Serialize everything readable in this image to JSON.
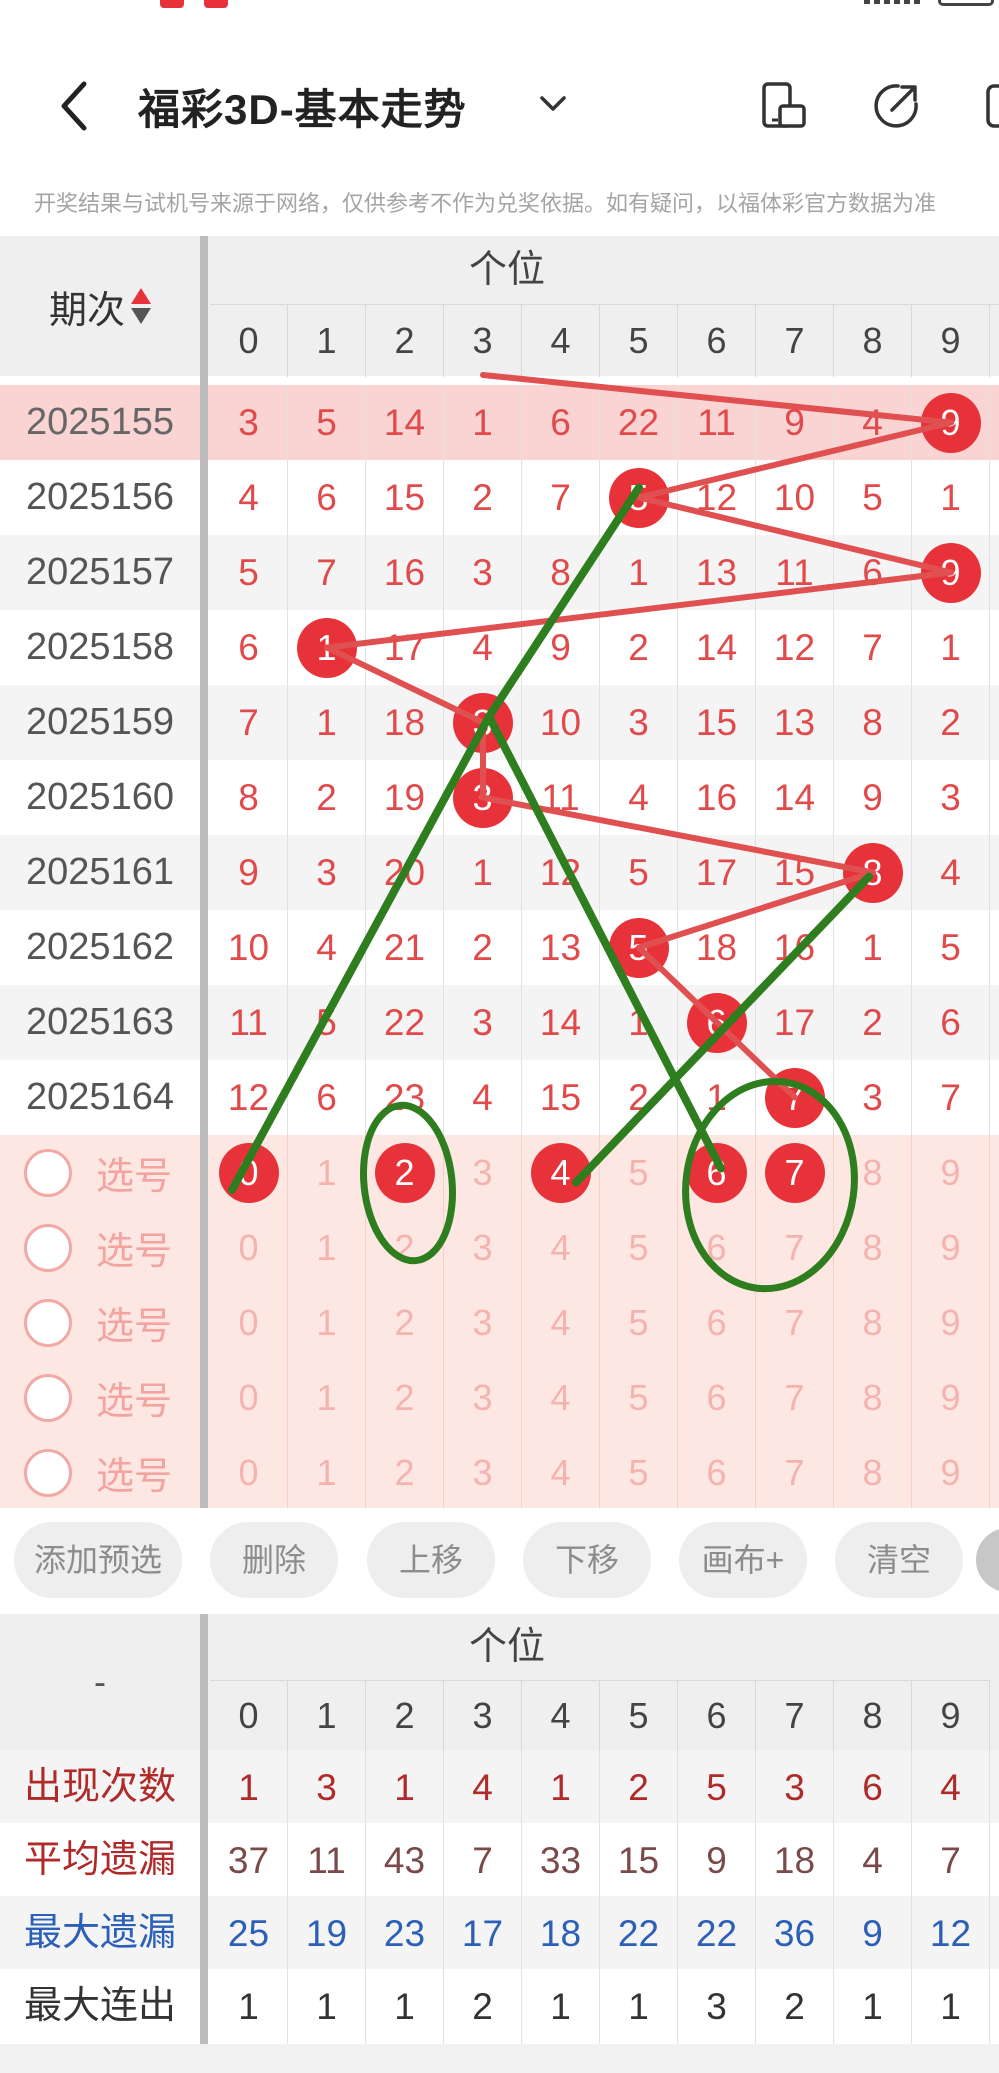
{
  "header": {
    "title": "福彩3D-基本走势"
  },
  "disclaimer": "开奖结果与试机号来源于网络，仅供参考不作为兑奖依据。如有疑问，以福体彩官方数据为准",
  "grid": {
    "period_header": "期次",
    "group_header": "个位",
    "digits": [
      "0",
      "1",
      "2",
      "3",
      "4",
      "5",
      "6",
      "7",
      "8",
      "9"
    ],
    "rows": [
      {
        "period": "2025155",
        "values": [
          "3",
          "5",
          "14",
          "1",
          "6",
          "22",
          "11",
          "9",
          "4",
          "9"
        ],
        "hit": 9,
        "highlight": true
      },
      {
        "period": "2025156",
        "values": [
          "4",
          "6",
          "15",
          "2",
          "7",
          "5",
          "12",
          "10",
          "5",
          "1"
        ],
        "hit": 5
      },
      {
        "period": "2025157",
        "values": [
          "5",
          "7",
          "16",
          "3",
          "8",
          "1",
          "13",
          "11",
          "6",
          "9"
        ],
        "hit": 9
      },
      {
        "period": "2025158",
        "values": [
          "6",
          "1",
          "17",
          "4",
          "9",
          "2",
          "14",
          "12",
          "7",
          "1"
        ],
        "hit": 1
      },
      {
        "period": "2025159",
        "values": [
          "7",
          "1",
          "18",
          "3",
          "10",
          "3",
          "15",
          "13",
          "8",
          "2"
        ],
        "hit": 3
      },
      {
        "period": "2025160",
        "values": [
          "8",
          "2",
          "19",
          "3",
          "11",
          "4",
          "16",
          "14",
          "9",
          "3"
        ],
        "hit": 3
      },
      {
        "period": "2025161",
        "values": [
          "9",
          "3",
          "20",
          "1",
          "12",
          "5",
          "17",
          "15",
          "8",
          "4"
        ],
        "hit": 8
      },
      {
        "period": "2025162",
        "values": [
          "10",
          "4",
          "21",
          "2",
          "13",
          "5",
          "18",
          "16",
          "1",
          "5"
        ],
        "hit": 5
      },
      {
        "period": "2025163",
        "values": [
          "11",
          "5",
          "22",
          "3",
          "14",
          "1",
          "6",
          "17",
          "2",
          "6"
        ],
        "hit": 6
      },
      {
        "period": "2025164",
        "values": [
          "12",
          "6",
          "23",
          "4",
          "15",
          "2",
          "1",
          "7",
          "3",
          "7"
        ],
        "hit": 7
      }
    ],
    "pick_label": "选号",
    "pick_rows": [
      {
        "selected": [
          0,
          2,
          4,
          6,
          7
        ]
      },
      {
        "selected": []
      },
      {
        "selected": []
      },
      {
        "selected": []
      },
      {
        "selected": []
      }
    ]
  },
  "toolbar": {
    "add": "添加预选",
    "delete": "删除",
    "up": "上移",
    "down": "下移",
    "canvas": "画布+",
    "clear": "清空"
  },
  "stats": {
    "dash": "-",
    "group_header": "个位",
    "digits": [
      "0",
      "1",
      "2",
      "3",
      "4",
      "5",
      "6",
      "7",
      "8",
      "9"
    ],
    "rows": [
      {
        "label": "出现次数",
        "values": [
          "1",
          "3",
          "1",
          "4",
          "1",
          "2",
          "5",
          "3",
          "6",
          "4"
        ],
        "label_color": "#b02a2a",
        "value_color": "#b02a2a"
      },
      {
        "label": "平均遗漏",
        "values": [
          "37",
          "11",
          "43",
          "7",
          "33",
          "15",
          "9",
          "18",
          "4",
          "7"
        ],
        "label_color": "#b02a2a",
        "value_color": "#7a4a4a"
      },
      {
        "label": "最大遗漏",
        "values": [
          "25",
          "19",
          "23",
          "17",
          "18",
          "22",
          "22",
          "36",
          "9",
          "12"
        ],
        "label_color": "#2b5fb8",
        "value_color": "#2b5fb8"
      },
      {
        "label": "最大连出",
        "values": [
          "1",
          "1",
          "1",
          "2",
          "1",
          "1",
          "3",
          "2",
          "1",
          "1"
        ],
        "label_color": "#333333",
        "value_color": "#333333"
      }
    ]
  },
  "colors": {
    "ball": "#e8323a",
    "trend_line": "#e05050",
    "annotation": "#2e7d1e"
  }
}
